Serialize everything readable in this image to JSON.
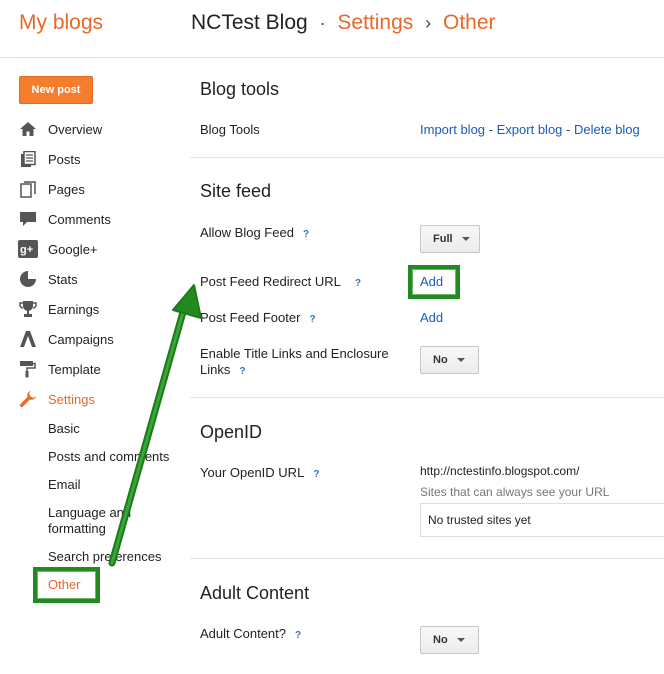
{
  "header": {
    "brand": "My blogs",
    "blog_name": "NCTest Blog",
    "sep1": "·",
    "crumb_settings": "Settings",
    "sep2": "›",
    "crumb_current": "Other"
  },
  "sidebar": {
    "new_post": "New post",
    "items": [
      {
        "label": "Overview",
        "icon": "home-icon"
      },
      {
        "label": "Posts",
        "icon": "posts-icon"
      },
      {
        "label": "Pages",
        "icon": "pages-icon"
      },
      {
        "label": "Comments",
        "icon": "comments-icon"
      },
      {
        "label": "Google+",
        "icon": "google-plus-icon"
      },
      {
        "label": "Stats",
        "icon": "stats-icon"
      },
      {
        "label": "Earnings",
        "icon": "trophy-icon"
      },
      {
        "label": "Campaigns",
        "icon": "campaigns-icon"
      },
      {
        "label": "Template",
        "icon": "paint-roller-icon"
      },
      {
        "label": "Settings",
        "icon": "wrench-icon"
      }
    ],
    "sub_items": [
      "Basic",
      "Posts and comments",
      "Email",
      "Language and formatting",
      "Search preferences",
      "Other"
    ]
  },
  "main": {
    "blog_tools": {
      "title": "Blog tools",
      "row_label": "Blog Tools",
      "import": "Import blog",
      "export": "Export blog",
      "delete": "Delete blog",
      "dash": "-"
    },
    "site_feed": {
      "title": "Site feed",
      "allow_label": "Allow Blog Feed",
      "allow_value": "Full",
      "redirect_label": "Post Feed Redirect URL",
      "redirect_action": "Add",
      "footer_label": "Post Feed Footer",
      "footer_action": "Add",
      "enclosure_label": "Enable Title Links and Enclosure Links",
      "enclosure_value": "No"
    },
    "openid": {
      "title": "OpenID",
      "url_label": "Your OpenID URL",
      "url_value": "http://nctestinfo.blogspot.com/",
      "note": "Sites that can always see your URL",
      "trusted": "No trusted sites yet"
    },
    "adult": {
      "title": "Adult Content",
      "label": "Adult Content?",
      "value": "No"
    },
    "help_glyph": "?"
  },
  "colors": {
    "accent": "#e8692a",
    "link": "#1a5bbd",
    "highlight": "#238a1f"
  }
}
